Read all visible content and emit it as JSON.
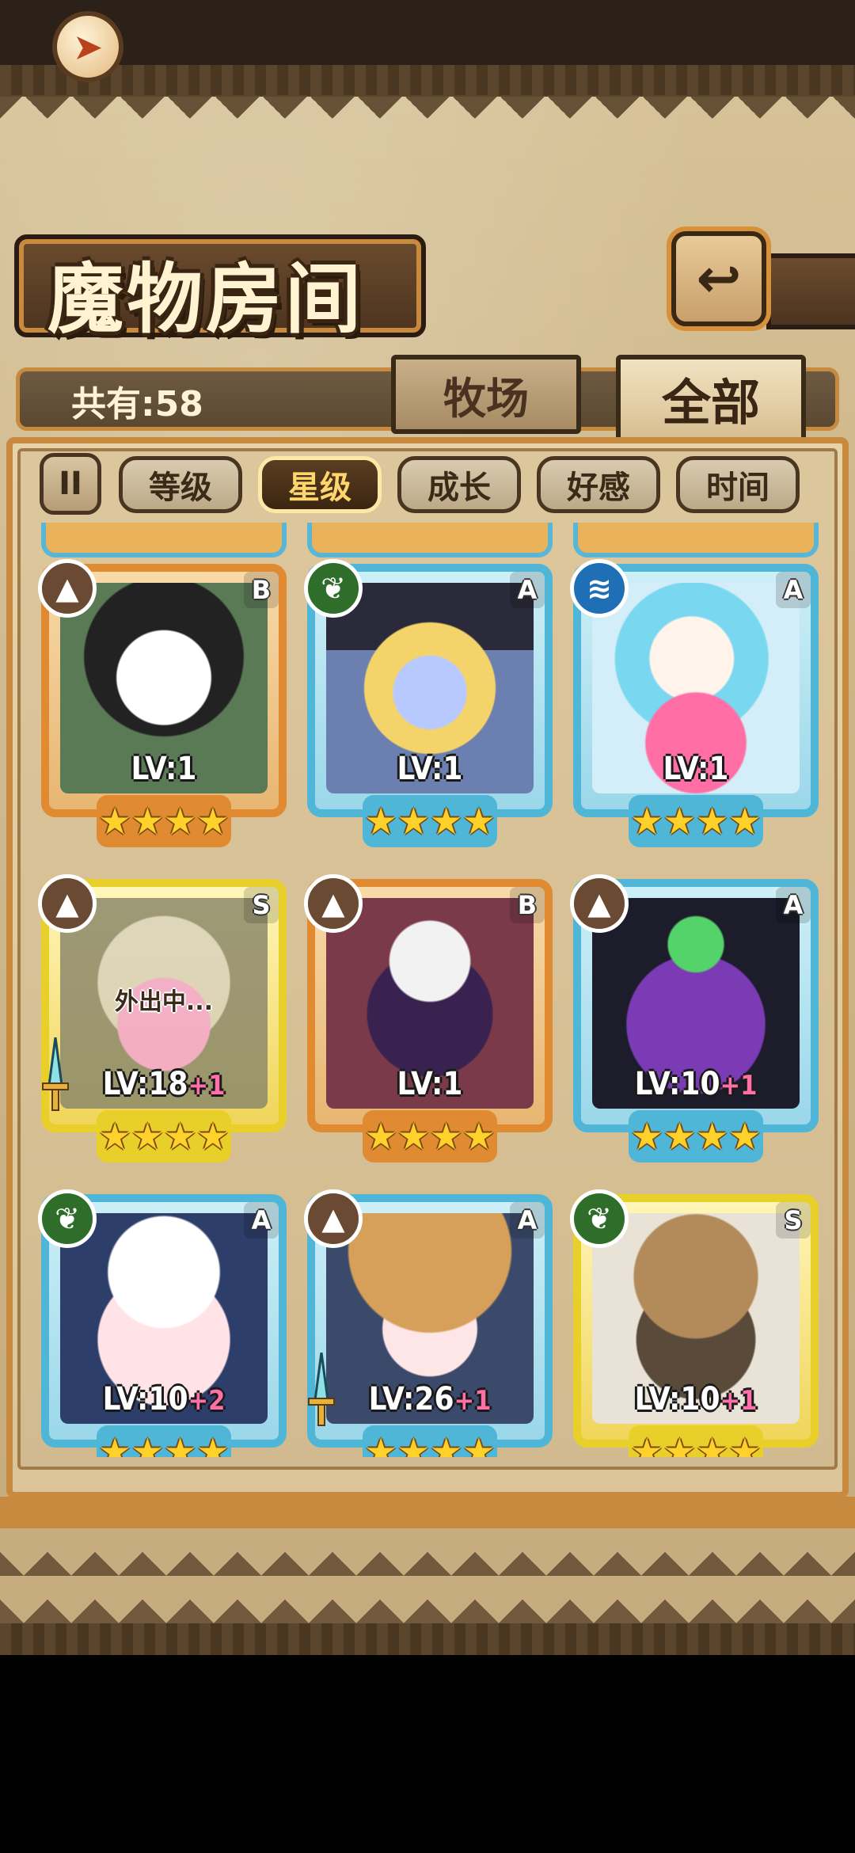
{
  "header": {
    "title": "魔物房间",
    "home_icon": "home-arrow-icon",
    "back_icon": "return-arrow-icon"
  },
  "counter": {
    "text": "共有:58"
  },
  "tabs": [
    {
      "label": "牧场",
      "active": false
    },
    {
      "label": "全部",
      "active": true
    }
  ],
  "filters": {
    "toggle_label": "II",
    "items": [
      {
        "label": "等级",
        "active": false
      },
      {
        "label": "星级",
        "active": true
      },
      {
        "label": "成长",
        "active": false
      },
      {
        "label": "好感",
        "active": false
      },
      {
        "label": "时间",
        "active": false
      }
    ]
  },
  "cards": [
    {
      "element": "earth-icon",
      "rank": "B",
      "level": "LV:1",
      "plus": "",
      "stars": "★★★★",
      "status": ""
    },
    {
      "element": "leaf-icon",
      "rank": "A",
      "level": "LV:1",
      "plus": "",
      "stars": "★★★★",
      "status": ""
    },
    {
      "element": "water-icon",
      "rank": "A",
      "level": "LV:1",
      "plus": "",
      "stars": "★★★★",
      "status": ""
    },
    {
      "element": "earth-icon",
      "rank": "S",
      "level": "LV:18",
      "plus": "+1",
      "stars": "★★★★",
      "status": "外出中..."
    },
    {
      "element": "earth-icon",
      "rank": "B",
      "level": "LV:1",
      "plus": "",
      "stars": "★★★★",
      "status": ""
    },
    {
      "element": "earth-icon",
      "rank": "A",
      "level": "LV:10",
      "plus": "+1",
      "stars": "★★★★",
      "status": ""
    },
    {
      "element": "leaf-icon",
      "rank": "A",
      "level": "LV:10",
      "plus": "+2",
      "stars": "★★★★",
      "status": ""
    },
    {
      "element": "earth-icon",
      "rank": "A",
      "level": "LV:26",
      "plus": "+1",
      "stars": "★★★★",
      "status": ""
    },
    {
      "element": "leaf-icon",
      "rank": "S",
      "level": "LV:10",
      "plus": "+1",
      "stars": "★★★★",
      "status": ""
    }
  ],
  "colors": {
    "accent": "#c88a3e",
    "frame_dark": "#3a2a18",
    "orange_card": "#e08a32",
    "blue_card": "#4fb6d8",
    "gold_card": "#e9cf2a"
  }
}
